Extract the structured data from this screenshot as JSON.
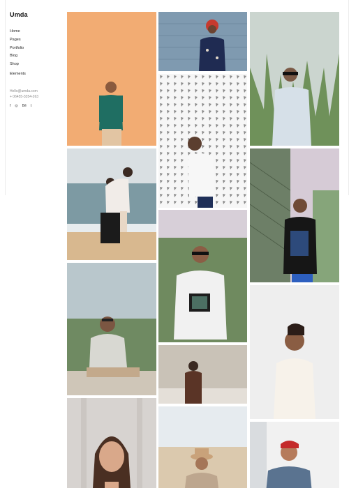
{
  "brand": {
    "logo": "Umda"
  },
  "menu": [
    {
      "label": "Home"
    },
    {
      "label": "Pages"
    },
    {
      "label": "Portfolio"
    },
    {
      "label": "Blog"
    },
    {
      "label": "Shop"
    },
    {
      "label": "Elements"
    }
  ],
  "contact": {
    "email": "Hello@umda.com",
    "phone": "+ 06455-3354-263"
  },
  "social": [
    {
      "icon": "facebook-icon",
      "glyph": "f"
    },
    {
      "icon": "instagram-icon",
      "glyph": "◎"
    },
    {
      "icon": "behance-icon",
      "glyph": "Bē"
    },
    {
      "icon": "twitter-icon",
      "glyph": "t"
    }
  ],
  "gallery": {
    "photos": [
      {
        "name": "man-green-polo-orange-wall",
        "bg": "#f0a86d"
      },
      {
        "name": "woman-red-hair-floral-shirt",
        "bg": "#7f9ab0"
      },
      {
        "name": "man-glasses-tall-grass",
        "bg": "#9fb59a"
      },
      {
        "name": "man-white-tee-pattern-wall",
        "bg": "#f4f4f4"
      },
      {
        "name": "couple-hugging-beach",
        "bg": "#c8d2d6"
      },
      {
        "name": "man-black-tee-fence",
        "bg": "#8ea58a"
      },
      {
        "name": "man-sunglasses-graphic-tee",
        "bg": "#a6b59b"
      },
      {
        "name": "man-striped-sweater-sitting",
        "bg": "#b5c4c7"
      },
      {
        "name": "woman-brown-top-wall",
        "bg": "#dad5cd"
      },
      {
        "name": "man-white-sweater-profile",
        "bg": "#eeeeee"
      },
      {
        "name": "woman-long-hair-portrait",
        "bg": "#d7d3d0"
      },
      {
        "name": "man-hat-desert",
        "bg": "#dbd3c6"
      },
      {
        "name": "man-red-cap-denim",
        "bg": "#f1f1f1"
      }
    ]
  }
}
